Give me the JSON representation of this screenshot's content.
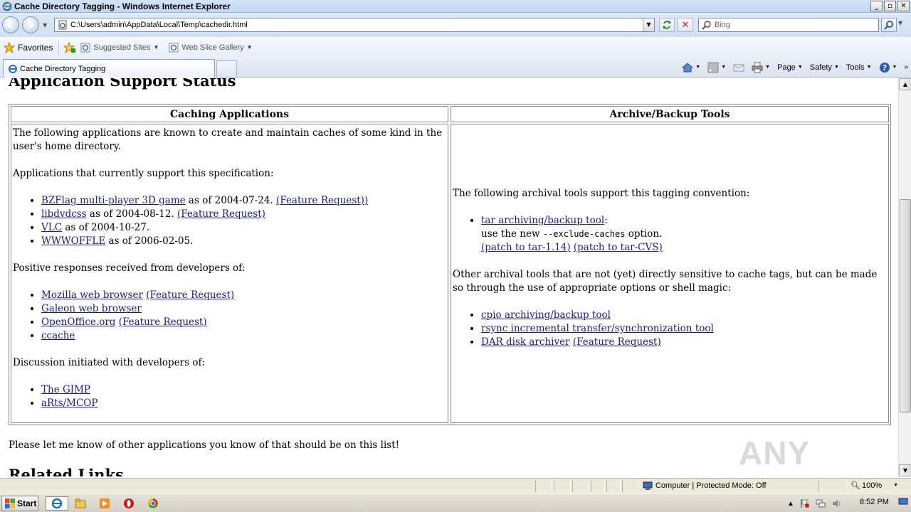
{
  "window": {
    "title": "Cache Directory Tagging - Windows Internet Explorer",
    "controls": [
      "_",
      "▫",
      "✕"
    ]
  },
  "address": {
    "url": "C:\\Users\\admin\\AppData\\Local\\Temp\\cachedir.html",
    "search_placeholder": "Bing"
  },
  "favorites": {
    "label": "Favorites",
    "items": [
      "Suggested Sites",
      "Web Slice Gallery"
    ]
  },
  "tabs": [
    {
      "label": "Cache Directory Tagging"
    }
  ],
  "commandbar": {
    "page": "Page",
    "safety": "Safety",
    "tools": "Tools"
  },
  "content": {
    "heading": "Application Support Status",
    "col1_header": "Caching Applications",
    "col2_header": "Archive/Backup Tools",
    "col1_intro": "The following applications are known to create and maintain caches of some kind in the user's home directory.",
    "col1_support_label": "Applications that currently support this specification:",
    "support": [
      {
        "link": "BZFlag multi-player 3D game",
        "text": " as of 2004-07-24. ",
        "extra": "(Feature Request)",
        "tail": ")"
      },
      {
        "link": "libdvdcss",
        "text": " as of 2004-08-12. ",
        "extra": "(Feature Request)",
        "tail": ""
      },
      {
        "link": "VLC",
        "text": " as of 2004-10-27.",
        "extra": "",
        "tail": ""
      },
      {
        "link": "WWWOFFLE",
        "text": " as of 2006-02-05.",
        "extra": "",
        "tail": ""
      }
    ],
    "col1_positive_label": "Positive responses received from developers of:",
    "positive": [
      {
        "link": "Mozilla web browser",
        "extra": "(Feature Request)"
      },
      {
        "link": "Galeon web browser",
        "extra": ""
      },
      {
        "link": "OpenOffice.org",
        "extra": "(Feature Request)"
      },
      {
        "link": "ccache",
        "extra": ""
      }
    ],
    "col1_discussion_label": "Discussion initiated with developers of:",
    "discussion": [
      {
        "link": "The GIMP"
      },
      {
        "link": "aRts/MCOP"
      }
    ],
    "col2_intro": "The following archival tools support this tagging convention:",
    "tar_link": "tar archiving/backup tool",
    "tar_colon": ":",
    "tar_use_prefix": "use the new ",
    "tar_option": "--exclude-caches",
    "tar_use_suffix": " option.",
    "tar_patch1": "(patch to tar-1.14)",
    "tar_patch2": "(patch to tar-CVS)",
    "col2_other": "Other archival tools that are not (yet) directly sensitive to cache tags, but can be made so through the use of appropriate options or shell magic:",
    "other_tools": [
      {
        "link": "cpio archiving/backup tool",
        "extra": ""
      },
      {
        "link": "rsync incremental transfer/synchronization tool",
        "extra": ""
      },
      {
        "link": "DAR disk archiver",
        "extra": "(Feature Request)"
      }
    ],
    "note": "Please let me know of other applications you know of that should be on this list!",
    "related_heading": "Related Links"
  },
  "watermark": "ANY RUN",
  "status": {
    "zone": "Computer | Protected Mode: Off",
    "zoom": "100%"
  },
  "taskbar": {
    "start": "Start",
    "clock": "8:52 PM"
  }
}
